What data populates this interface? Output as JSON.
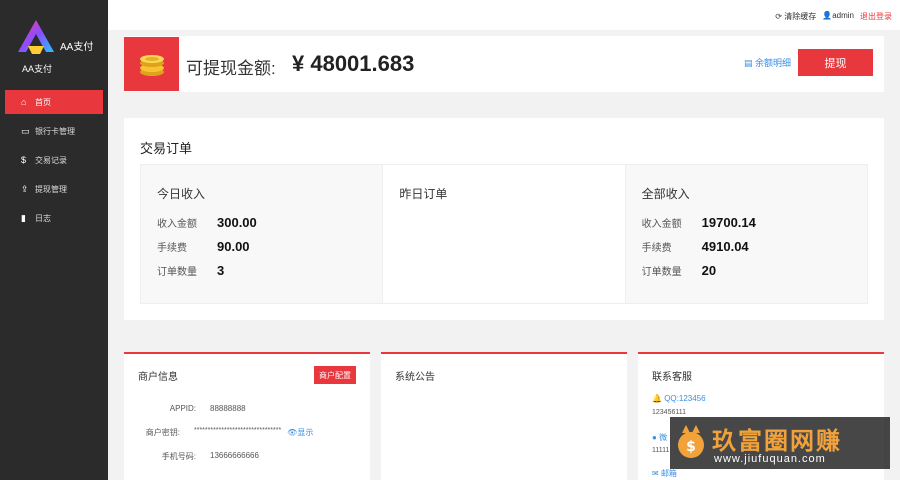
{
  "brand": {
    "name": "AA支付",
    "subtitle": "AA支付"
  },
  "nav": [
    {
      "icon": "home-icon",
      "glyph": "⌂",
      "label": "首页",
      "active": true
    },
    {
      "icon": "card-icon",
      "glyph": "▭",
      "label": "银行卡管理",
      "active": false
    },
    {
      "icon": "dollar-icon",
      "glyph": "$",
      "label": "交易记录",
      "active": false
    },
    {
      "icon": "upload-icon",
      "glyph": "⇪",
      "label": "提现管理",
      "active": false
    },
    {
      "icon": "document-icon",
      "glyph": "▮",
      "label": "日志",
      "active": false
    }
  ],
  "topbar": {
    "clear_cache": "⟳ 清除缓存",
    "user": "admin",
    "logout": "退出登录"
  },
  "balance": {
    "label": "可提现金额:",
    "value": "¥ 48001.683",
    "detail_link": "余额明细",
    "withdraw_button": "提现"
  },
  "orders": {
    "title": "交易订单",
    "today": {
      "title": "今日收入",
      "income_label": "收入金额",
      "income": "300.00",
      "fee_label": "手续费",
      "fee": "90.00",
      "count_label": "订单数量",
      "count": "3"
    },
    "yesterday": {
      "title": "昨日订单"
    },
    "total": {
      "title": "全部收入",
      "income_label": "收入金额",
      "income": "19700.14",
      "fee_label": "手续费",
      "fee": "4910.04",
      "count_label": "订单数量",
      "count": "20"
    }
  },
  "merchant": {
    "title": "商户信息",
    "config_button": "商户配置",
    "appid_label": "APPID:",
    "appid": "88888888",
    "key_label": "商户密钥:",
    "key": "********************************",
    "show_link": "显示",
    "phone_label": "手机号码:",
    "phone": "13666666666"
  },
  "notice": {
    "title": "系统公告"
  },
  "support": {
    "title": "联系客服",
    "qq": "QQ:123456",
    "qq_number": "123456111",
    "wechat_label": "微",
    "wechat_number": "11111",
    "email_label": "邮箱"
  },
  "watermark": {
    "title": "玖富圈网赚",
    "url": "www.jiufuquan.com"
  },
  "colors": {
    "accent": "#e8373d",
    "sidebar": "#2b2b2b",
    "link": "#3a8ee6"
  }
}
